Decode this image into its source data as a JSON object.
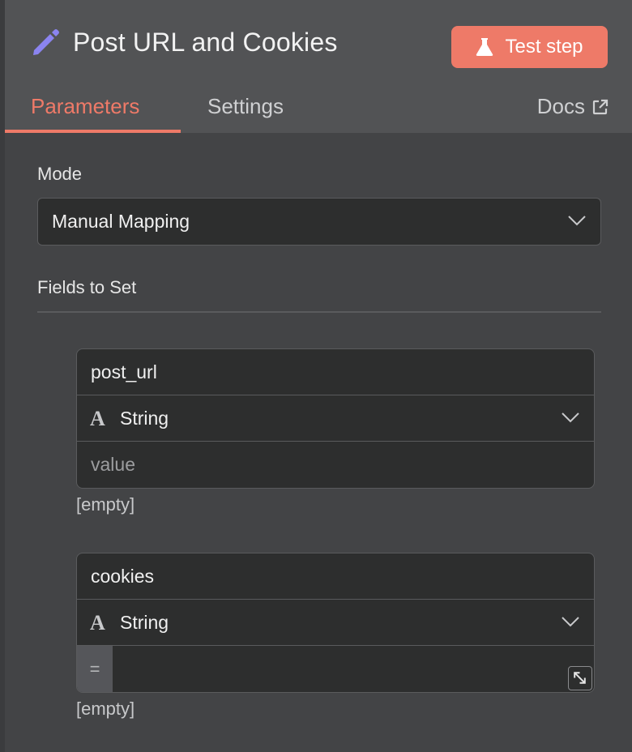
{
  "header": {
    "title": "Post URL and Cookies",
    "test_step_label": "Test step",
    "icon": "pencil-icon"
  },
  "tabs": {
    "parameters": "Parameters",
    "settings": "Settings",
    "docs": "Docs"
  },
  "mode": {
    "label": "Mode",
    "value": "Manual Mapping"
  },
  "fields_section": {
    "label": "Fields to Set",
    "fields": [
      {
        "name": "post_url",
        "type": "String",
        "value_placeholder": "value",
        "hint": "[empty]"
      },
      {
        "name": "cookies",
        "type": "String",
        "value_prefix": "=",
        "hint": "[empty]"
      }
    ]
  },
  "colors": {
    "accent": "#ee7a68",
    "icon_accent": "#8b84f0"
  }
}
